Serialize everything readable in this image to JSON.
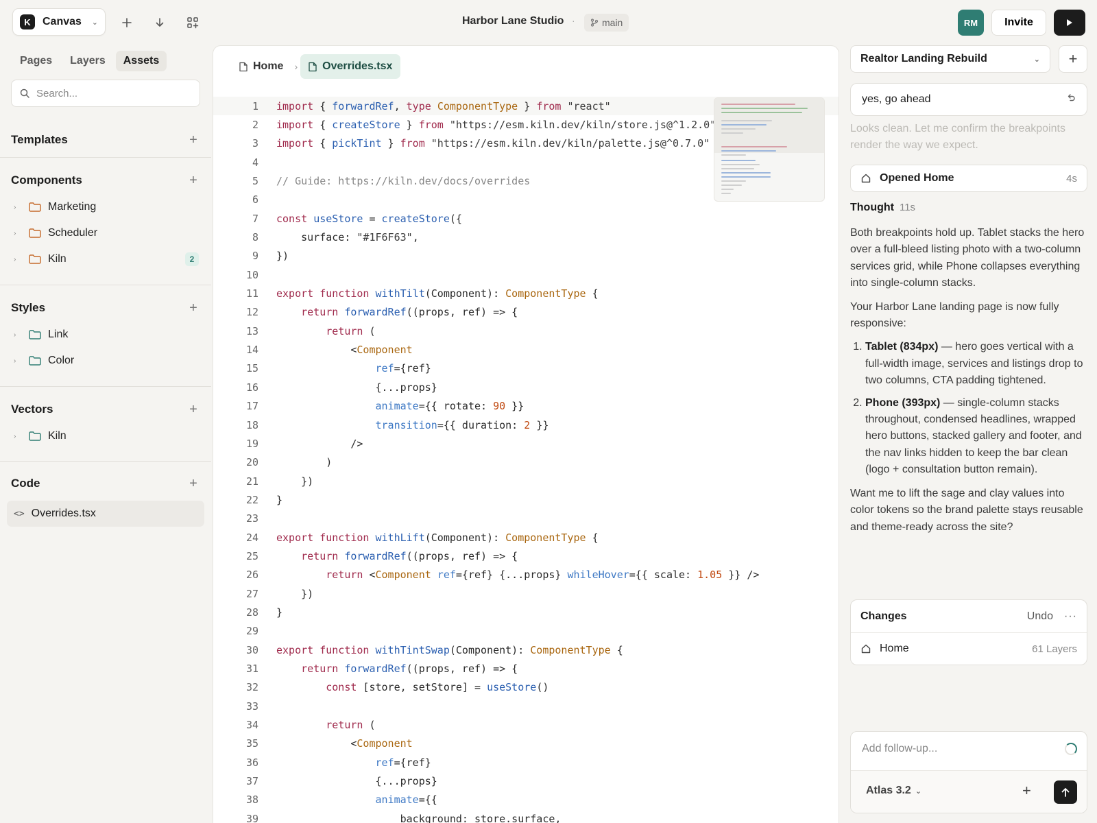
{
  "topbar": {
    "app_name": "Canvas",
    "project_name": "Harbor Lane Studio",
    "separator": "·",
    "branch": "main",
    "avatar_initials": "RM",
    "invite_label": "Invite"
  },
  "sidebar": {
    "tabs": [
      {
        "label": "Pages",
        "active": false
      },
      {
        "label": "Layers",
        "active": false
      },
      {
        "label": "Assets",
        "active": true
      }
    ],
    "search_placeholder": "Search...",
    "sections": {
      "templates": {
        "title": "Templates"
      },
      "components": {
        "title": "Components",
        "items": [
          {
            "label": "Marketing"
          },
          {
            "label": "Scheduler"
          },
          {
            "label": "Kiln",
            "badge": "2"
          }
        ]
      },
      "styles": {
        "title": "Styles",
        "items": [
          {
            "label": "Link"
          },
          {
            "label": "Color"
          }
        ]
      },
      "vectors": {
        "title": "Vectors",
        "items": [
          {
            "label": "Kiln"
          }
        ]
      },
      "code": {
        "title": "Code",
        "file": "Overrides.tsx"
      }
    }
  },
  "editor": {
    "breadcrumb": [
      "Home",
      "Overrides.tsx"
    ],
    "lines": [
      "import { forwardRef, type ComponentType } from \"react\"",
      "import { createStore } from \"https://esm.kiln.dev/kiln/store.js@^1.2.0\"",
      "import { pickTint } from \"https://esm.kiln.dev/kiln/palette.js@^0.7.0\"",
      "",
      "// Guide: https://kiln.dev/docs/overrides",
      "",
      "const useStore = createStore({",
      "    surface: \"#1F6F63\",",
      "})",
      "",
      "export function withTilt(Component): ComponentType {",
      "    return forwardRef((props, ref) => {",
      "        return (",
      "            <Component",
      "                ref={ref}",
      "                {...props}",
      "                animate={{ rotate: 90 }}",
      "                transition={{ duration: 2 }}",
      "            />",
      "        )",
      "    })",
      "}",
      "",
      "export function withLift(Component): ComponentType {",
      "    return forwardRef((props, ref) => {",
      "        return <Component ref={ref} {...props} whileHover={{ scale: 1.05 }} />",
      "    })",
      "}",
      "",
      "export function withTintSwap(Component): ComponentType {",
      "    return forwardRef((props, ref) => {",
      "        const [store, setStore] = useStore()",
      "",
      "        return (",
      "            <Component",
      "                ref={ref}",
      "                {...props}",
      "                animate={{",
      "                    background: store.surface,"
    ]
  },
  "assistant": {
    "project_select": "Realtor Landing Rebuild",
    "user_message": "yes, go ahead",
    "faded_text": "Looks clean. Let me confirm the breakpoints render the way we expect.",
    "tool_call": {
      "label": "Opened Home",
      "duration": "4s"
    },
    "thought": {
      "label": "Thought",
      "duration": "11s"
    },
    "paragraph1": "Both breakpoints hold up. Tablet stacks the hero over a full-bleed listing photo with a two-column services grid, while Phone collapses everything into single-column stacks.",
    "paragraph2": "Your Harbor Lane landing page is now fully responsive:",
    "list": [
      {
        "bold": "Tablet (834px)",
        "text": " — hero goes vertical with a full-width image, services and listings drop to two columns, CTA padding tightened."
      },
      {
        "bold": "Phone (393px)",
        "text": " — single-column stacks throughout, condensed headlines, wrapped hero buttons, stacked gallery and footer, and the nav links hidden to keep the bar clean (logo + consultation button remain)."
      }
    ],
    "paragraph3": "Want me to lift the sage and clay values into color tokens so the brand palette stays reusable and theme-ready across the site?",
    "changes": {
      "title": "Changes",
      "undo": "Undo",
      "more": "···",
      "row_label": "Home",
      "row_meta": "61 Layers"
    },
    "composer": {
      "placeholder": "Add follow-up...",
      "model": "Atlas 3.2"
    }
  },
  "colors": {
    "accent": "#2f7d73",
    "dark": "#1c1c1c"
  }
}
